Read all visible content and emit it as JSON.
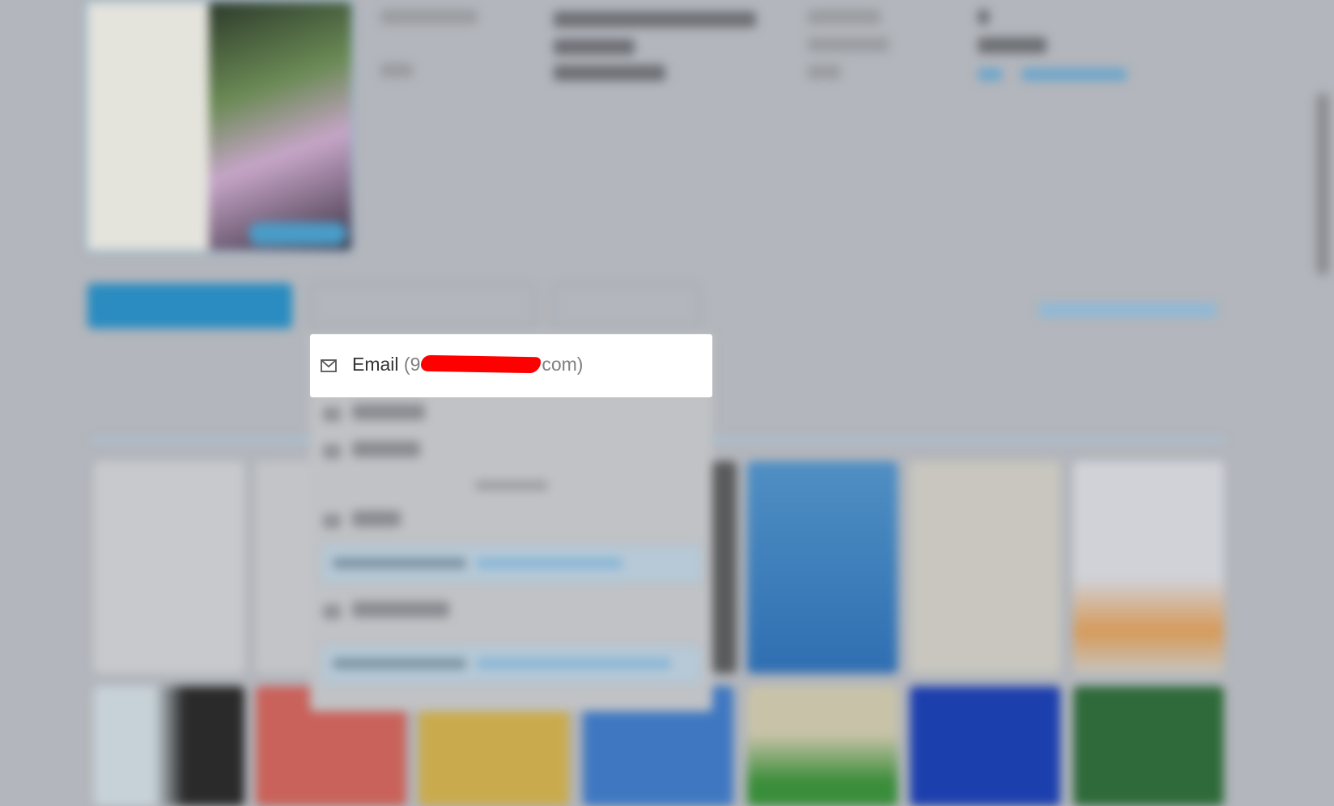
{
  "email_menu_item": {
    "label": "Email",
    "address_prefix": "(9",
    "address_suffix": "com)",
    "icon": "mail-icon"
  },
  "colors": {
    "backdrop": "#b3b6bc",
    "menu_item_bg": "#ffffff",
    "redaction": "#ff0000",
    "primary_button": "#2a8cc0"
  }
}
